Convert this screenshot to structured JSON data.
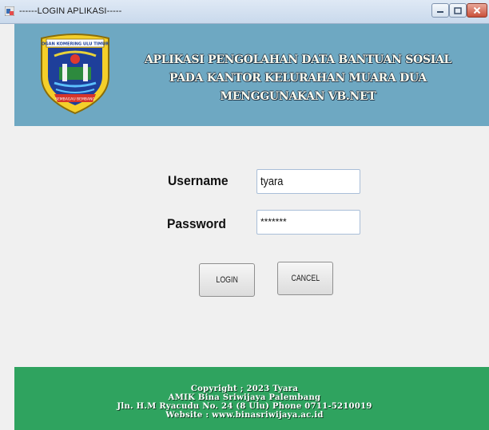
{
  "window": {
    "title": "------LOGIN APLIKASI-----",
    "icons": [
      "app-icon",
      "minimize-icon",
      "maximize-icon",
      "close-icon"
    ]
  },
  "header": {
    "logo_text": "OGAN KOMERING ULU TIMUR",
    "logo_ribbon": "SEMBAGAU BEMBANG",
    "line1": "APLIKASI PENGOLAHAN DATA BANTUAN SOSIAL",
    "line2": "PADA KANTOR KELURAHAN MUARA DUA",
    "line3": "MENGGUNAKAN VB.NET"
  },
  "form": {
    "username_label": "Username",
    "password_label": "Password",
    "username_value": "tyara",
    "password_value": "*******",
    "login_label": "LOGIN",
    "cancel_label": "CANCEL"
  },
  "footer": {
    "line1": "Copyright ; 2023 Tyara",
    "line2": "AMIK Bina Sriwijaya Palembang",
    "line3": "Jln. H.M Ryacudu No. 24 (8 Ulu) Phone 0711-5210019",
    "line4": "Website : www.binasriwijaya.ac.id"
  },
  "colors": {
    "header_bg": "#6ea8c2",
    "footer_bg": "#2fa35f",
    "form_bg": "#f0f0f0"
  }
}
